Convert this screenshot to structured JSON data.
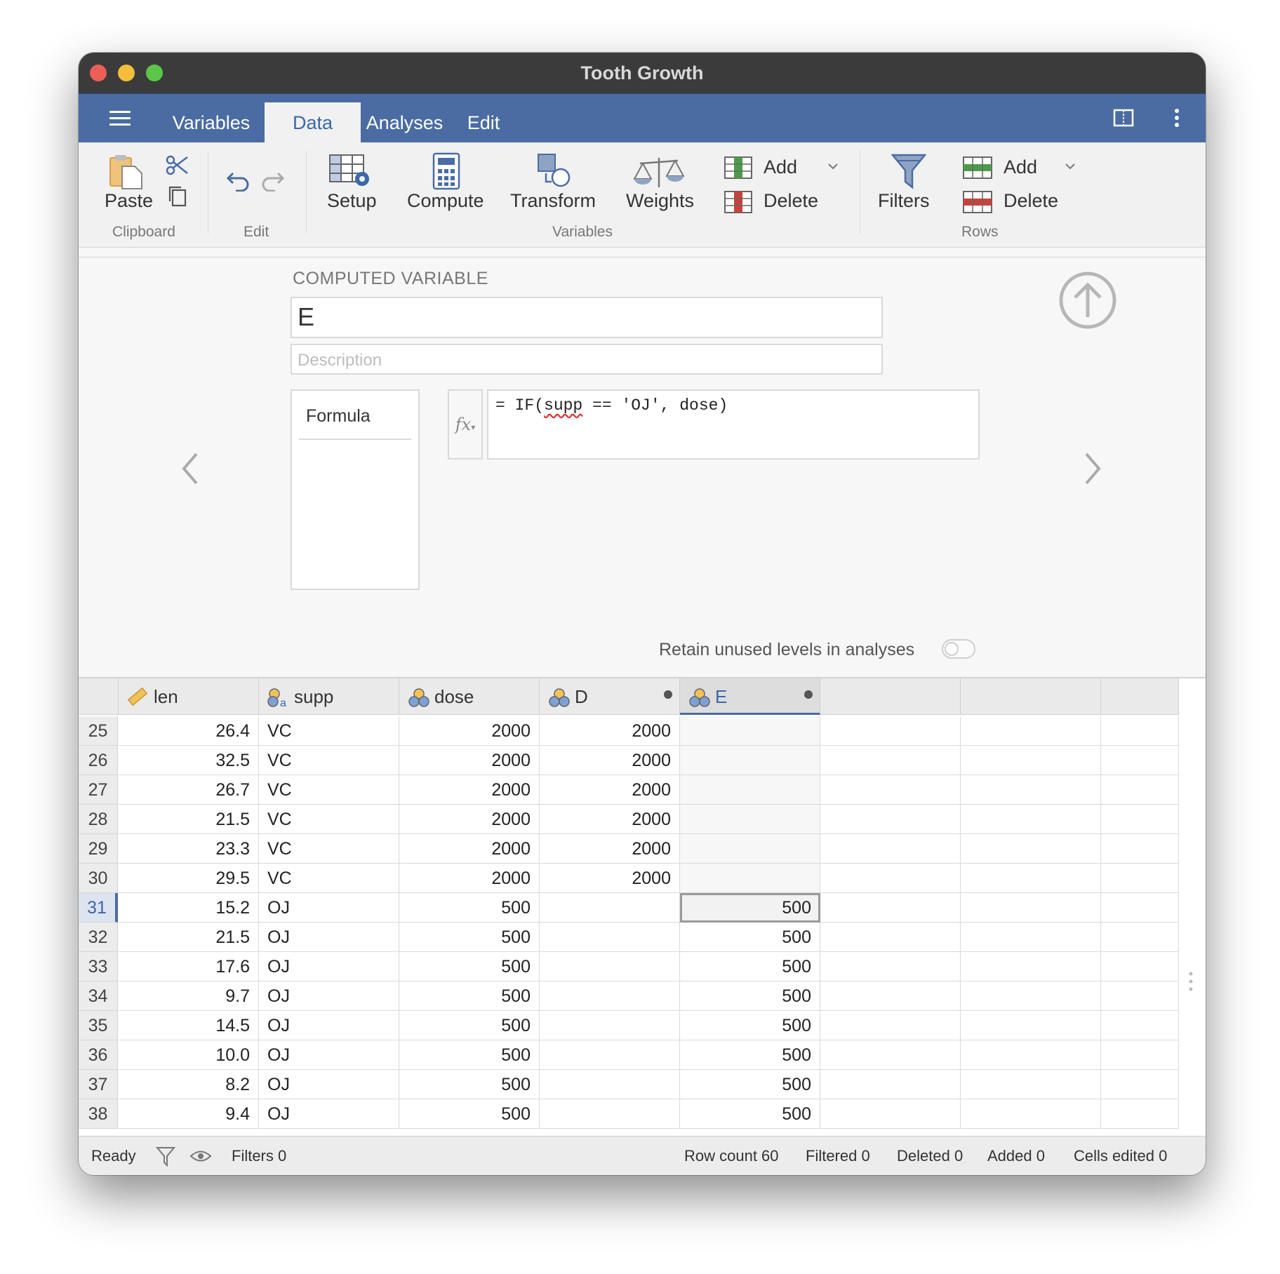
{
  "window": {
    "title": "Tooth Growth"
  },
  "menu": {
    "tabs": [
      "Variables",
      "Data",
      "Analyses",
      "Edit"
    ],
    "active": "Data"
  },
  "ribbon": {
    "paste": "Paste",
    "clipboard_group": "Clipboard",
    "edit_group": "Edit",
    "setup": "Setup",
    "compute": "Compute",
    "transform": "Transform",
    "weights": "Weights",
    "var_add": "Add",
    "var_delete": "Delete",
    "variables_group": "Variables",
    "filters": "Filters",
    "row_add": "Add",
    "row_delete": "Delete",
    "rows_group": "Rows"
  },
  "editor": {
    "section_title": "COMPUTED VARIABLE",
    "name": "E",
    "description_placeholder": "Description",
    "formula_label": "Formula",
    "fx": "fx",
    "formula_pre": "= IF(",
    "formula_squiggle": "supp",
    "formula_post": " == 'OJ', dose)",
    "retain_label": "Retain unused levels in analyses"
  },
  "grid": {
    "columns": [
      {
        "name": "len",
        "icon": "ruler-icon"
      },
      {
        "name": "supp",
        "icon": "nominal-text-icon"
      },
      {
        "name": "dose",
        "icon": "nominal-icon"
      },
      {
        "name": "D",
        "icon": "nominal-icon"
      },
      {
        "name": "E",
        "icon": "nominal-icon"
      }
    ],
    "rows": [
      {
        "n": "25",
        "len": "26.4",
        "supp": "VC",
        "dose": "2000",
        "D": "2000",
        "E": ""
      },
      {
        "n": "26",
        "len": "32.5",
        "supp": "VC",
        "dose": "2000",
        "D": "2000",
        "E": ""
      },
      {
        "n": "27",
        "len": "26.7",
        "supp": "VC",
        "dose": "2000",
        "D": "2000",
        "E": ""
      },
      {
        "n": "28",
        "len": "21.5",
        "supp": "VC",
        "dose": "2000",
        "D": "2000",
        "E": ""
      },
      {
        "n": "29",
        "len": "23.3",
        "supp": "VC",
        "dose": "2000",
        "D": "2000",
        "E": ""
      },
      {
        "n": "30",
        "len": "29.5",
        "supp": "VC",
        "dose": "2000",
        "D": "2000",
        "E": ""
      },
      {
        "n": "31",
        "len": "15.2",
        "supp": "OJ",
        "dose": "500",
        "D": "",
        "E": "500"
      },
      {
        "n": "32",
        "len": "21.5",
        "supp": "OJ",
        "dose": "500",
        "D": "",
        "E": "500"
      },
      {
        "n": "33",
        "len": "17.6",
        "supp": "OJ",
        "dose": "500",
        "D": "",
        "E": "500"
      },
      {
        "n": "34",
        "len": "9.7",
        "supp": "OJ",
        "dose": "500",
        "D": "",
        "E": "500"
      },
      {
        "n": "35",
        "len": "14.5",
        "supp": "OJ",
        "dose": "500",
        "D": "",
        "E": "500"
      },
      {
        "n": "36",
        "len": "10.0",
        "supp": "OJ",
        "dose": "500",
        "D": "",
        "E": "500"
      },
      {
        "n": "37",
        "len": "8.2",
        "supp": "OJ",
        "dose": "500",
        "D": "",
        "E": "500"
      },
      {
        "n": "38",
        "len": "9.4",
        "supp": "OJ",
        "dose": "500",
        "D": "",
        "E": "500"
      }
    ],
    "current_row": "31"
  },
  "status": {
    "ready": "Ready",
    "filters": "Filters 0",
    "row_count": "Row count 60",
    "filtered": "Filtered 0",
    "deleted": "Deleted 0",
    "added": "Added 0",
    "cells_edited": "Cells edited 0"
  }
}
